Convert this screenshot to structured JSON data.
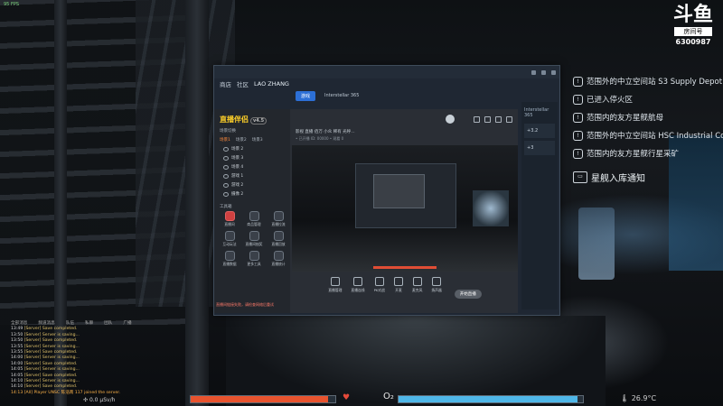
{
  "hud": {
    "corner_tag": "95 FPS",
    "douyu": {
      "logo": "斗鱼",
      "room_label": "房间号",
      "room_number": "6300987"
    },
    "objectives": [
      {
        "mark": "!",
        "text": "范围外的中立空间站 S3 Supply Depot"
      },
      {
        "mark": "!",
        "text": "已进入停火区"
      },
      {
        "mark": "!",
        "text": "范围内的友方星舰航母"
      },
      {
        "mark": "!",
        "text": "范围外的中立空间站 HSC Industrial Cor"
      },
      {
        "mark": "!",
        "text": "范围内的友方星舰行星采矿"
      }
    ],
    "notice": {
      "mark": "▭",
      "text": "星舰入库通知"
    },
    "chat": {
      "headers": [
        "全部消息",
        "频道消息",
        "队伍",
        "私聊",
        "团队",
        "广播"
      ],
      "lines": [
        {
          "time": "13:49",
          "text": "[Server] Save completed."
        },
        {
          "time": "13:50",
          "text": "[Server] Server is saving..."
        },
        {
          "time": "13:50",
          "text": "[Server] Save completed."
        },
        {
          "time": "13:55",
          "text": "[Server] Server is saving..."
        },
        {
          "time": "13:55",
          "text": "[Server] Save completed."
        },
        {
          "time": "14:00",
          "text": "[Server] Server is saving..."
        },
        {
          "time": "14:00",
          "text": "[Server] Save completed."
        },
        {
          "time": "14:05",
          "text": "[Server] Server is saving..."
        },
        {
          "time": "14:05",
          "text": "[Server] Save completed."
        },
        {
          "time": "14:10",
          "text": "[Server] Server is saving..."
        },
        {
          "time": "14:10",
          "text": "[Server] Save completed."
        },
        {
          "time": "14:13",
          "text": "[All] Player UNSC 陈浩南 117 joined the server."
        }
      ]
    },
    "stat_left": "0.0 μSv/h",
    "stat_right": "26.9°C",
    "o2_label": "O₂",
    "health_level": 0.95,
    "o2_level": 0.97,
    "colors": {
      "health": "#e8532e",
      "o2": "#4fb7e8"
    }
  },
  "window": {
    "title_icons": [
      "minimize",
      "maximize",
      "close"
    ],
    "nav": [
      "商店",
      "社区"
    ],
    "user": "LAO ZHANG",
    "tabs": {
      "active": "游戏",
      "other": "Interstellar 365"
    },
    "right_panel": {
      "item": "Interstellar 365",
      "blocks": [
        "+3.2",
        "+3"
      ]
    }
  },
  "app": {
    "logo": "直播伴侣",
    "version": "v4.5",
    "scene_title": "场景切换",
    "scene_tabs": [
      "场景1",
      "场景2",
      "场景3"
    ],
    "scene_items": [
      "场景 2",
      "场景 3",
      "场景 4",
      "游戏 1",
      "游戏 2",
      "摄像 2"
    ],
    "tools_title": "工具箱",
    "tools": [
      "直播间",
      "商品管理",
      "直播拉流",
      "互动玩法",
      "直播间抽奖",
      "直播回放",
      "直播数据",
      "更多工具",
      "直播统计"
    ],
    "room_info": "影视 直播 佰万 小众 稀有 光呼…",
    "room_sub": "• 已开播 ID: 00000   • 观看 0",
    "bottom_buttons": [
      "直播管理",
      "直播连线",
      "PK对战",
      "开麦",
      "麦克风",
      "扬声器"
    ],
    "start_label": "开始直播",
    "footer": "直播间链接失败，请检查网络后重试"
  }
}
